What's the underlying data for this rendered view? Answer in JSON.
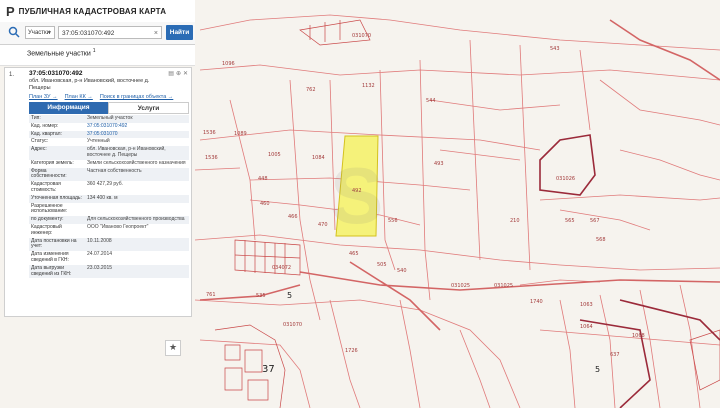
{
  "app": {
    "logo": "P",
    "title": "ПУБЛИЧНАЯ КАДАСТРОВАЯ КАРТА"
  },
  "search": {
    "type_label": "Участки",
    "query": "37:05:031070:492",
    "find_label": "Найти"
  },
  "results": {
    "title": "Земельные участки",
    "count": "1",
    "item": {
      "index": "1.",
      "cadnum": "37:05:031070:492",
      "address": "обл. Ивановская, р-н Ивановский, восточнее д. Пещеры",
      "links": [
        "План ЗУ →",
        "План КК →",
        "Поиск в границах объекта →"
      ],
      "tabs": [
        "Информация",
        "Услуги"
      ],
      "rows": [
        {
          "k": "Тип:",
          "v": "Земельный участок",
          "link": false
        },
        {
          "k": "Кад. номер:",
          "v": "37:05:031070:492",
          "link": true
        },
        {
          "k": "Кад. квартал:",
          "v": "37:05:031070",
          "link": true
        },
        {
          "k": "Статус:",
          "v": "Учтенный",
          "link": false
        },
        {
          "k": "Адрес:",
          "v": "обл. Ивановская, р-н Ивановский, восточнее д. Пещеры",
          "link": false
        },
        {
          "k": "Категория земель:",
          "v": "Земли сельскохозяйственного назначения",
          "link": false
        },
        {
          "k": "Форма собственности:",
          "v": "Частная собственность",
          "link": false
        },
        {
          "k": "Кадастровая стоимость:",
          "v": "360 427,29 руб.",
          "link": false
        },
        {
          "k": "Уточненная площадь:",
          "v": "134 400 кв. м",
          "link": false
        },
        {
          "k": "Разрешенное использование:",
          "v": "",
          "link": false
        },
        {
          "k": "по документу:",
          "v": "Для сельскохозяйственного производства",
          "link": false
        },
        {
          "k": "Кадастровый инженер:",
          "v": "ООО \"Иваново Геопроект\"",
          "link": false
        },
        {
          "k": "Дата постановки на учет:",
          "v": "10.11.2008",
          "link": false
        },
        {
          "k": "Дата изменения сведений в ГКН:",
          "v": "24.07.2014",
          "link": false
        },
        {
          "k": "Дата выгрузки сведений из ГКН:",
          "v": "23.03.2015",
          "link": false
        }
      ]
    }
  },
  "map": {
    "labels": [
      {
        "t": "031070"
      },
      {
        "t": "1096"
      },
      {
        "t": "762"
      },
      {
        "t": "1132"
      },
      {
        "t": "544"
      },
      {
        "t": "543"
      },
      {
        "t": "1089"
      },
      {
        "t": "1536"
      },
      {
        "t": "1084"
      },
      {
        "t": "1005"
      },
      {
        "t": "1536"
      },
      {
        "t": "493"
      },
      {
        "t": "492"
      },
      {
        "t": "448"
      },
      {
        "t": "460"
      },
      {
        "t": "466"
      },
      {
        "t": "470"
      },
      {
        "t": "556"
      },
      {
        "t": "465"
      },
      {
        "t": "505"
      },
      {
        "t": "540"
      },
      {
        "t": "031026"
      },
      {
        "t": "565"
      },
      {
        "t": "567"
      },
      {
        "t": "568"
      },
      {
        "t": "034072"
      },
      {
        "t": "5"
      },
      {
        "t": "535"
      },
      {
        "t": "761"
      },
      {
        "t": "031025"
      },
      {
        "t": "031025"
      },
      {
        "t": "1740"
      },
      {
        "t": "1063"
      },
      {
        "t": "1064"
      },
      {
        "t": "031070"
      },
      {
        "t": "1726"
      },
      {
        "t": "37"
      },
      {
        "t": "5"
      },
      {
        "t": "637"
      },
      {
        "t": "1068"
      },
      {
        "t": "210"
      },
      {
        "t": "0231"
      }
    ],
    "line_color": "#e07a7a",
    "dark_line_color": "#9b2a3a",
    "highlight_color": "#f5f27a"
  },
  "favorite_icon": "star-icon"
}
